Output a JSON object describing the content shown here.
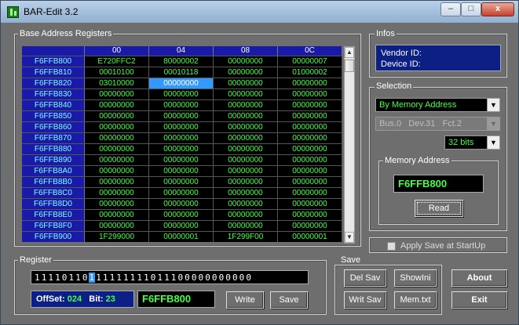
{
  "window": {
    "title": "BAR-Edit 3.2",
    "minimize": "–",
    "maximize": "□",
    "close": "x"
  },
  "bar": {
    "legend": "Base Address Registers",
    "headers": [
      "00",
      "04",
      "08",
      "0C"
    ],
    "rows": [
      {
        "addr": "F6FFB800",
        "v": [
          "E720FFC2",
          "80000002",
          "00000000",
          "00000007"
        ]
      },
      {
        "addr": "F6FFB810",
        "v": [
          "00010100",
          "00010118",
          "00000000",
          "01000002"
        ]
      },
      {
        "addr": "F6FFB820",
        "v": [
          "03010000",
          "00000000",
          "00000000",
          "00000000"
        ]
      },
      {
        "addr": "F6FFB830",
        "v": [
          "00000000",
          "00000000",
          "00000000",
          "00000000"
        ]
      },
      {
        "addr": "F6FFB840",
        "v": [
          "00000000",
          "00000000",
          "00000000",
          "00000000"
        ]
      },
      {
        "addr": "F6FFB850",
        "v": [
          "00000000",
          "00000000",
          "00000000",
          "00000000"
        ]
      },
      {
        "addr": "F6FFB860",
        "v": [
          "00000000",
          "00000000",
          "00000000",
          "00000000"
        ]
      },
      {
        "addr": "F6FFB870",
        "v": [
          "00000000",
          "00000000",
          "00000000",
          "00000000"
        ]
      },
      {
        "addr": "F6FFB880",
        "v": [
          "00000000",
          "00000000",
          "00000000",
          "00000000"
        ]
      },
      {
        "addr": "F6FFB890",
        "v": [
          "00000000",
          "00000000",
          "00000000",
          "00000000"
        ]
      },
      {
        "addr": "F6FFB8A0",
        "v": [
          "00000000",
          "00000000",
          "00000000",
          "00000000"
        ]
      },
      {
        "addr": "F6FFB8B0",
        "v": [
          "00000000",
          "00000000",
          "00000000",
          "00000000"
        ]
      },
      {
        "addr": "F6FFB8C0",
        "v": [
          "00000000",
          "00000000",
          "00000000",
          "00000000"
        ]
      },
      {
        "addr": "F6FFB8D0",
        "v": [
          "00000000",
          "00000000",
          "00000000",
          "00000000"
        ]
      },
      {
        "addr": "F6FFB8E0",
        "v": [
          "00000000",
          "00000000",
          "00000000",
          "00000000"
        ]
      },
      {
        "addr": "F6FFB8F0",
        "v": [
          "00000000",
          "00000000",
          "00000000",
          "00000000"
        ]
      },
      {
        "addr": "F6FFB900",
        "v": [
          "1F299000",
          "00000001",
          "1F299F00",
          "00000001"
        ]
      }
    ],
    "selected": {
      "row": 2,
      "col": 1
    }
  },
  "infos": {
    "legend": "Infos",
    "vendor": "Vendor ID:",
    "device": "Device ID:"
  },
  "selection": {
    "legend": "Selection",
    "mode": "By Memory Address",
    "pci": "Bus.0   Dev.31   Fct.2",
    "width": "32 bits",
    "memory_legend": "Memory Address",
    "memory_address": "F6FFB800",
    "read": "Read"
  },
  "apply_save": "Apply Save at StartUp",
  "register": {
    "legend": "Register",
    "bits": "11110110111111111011100000000000",
    "cursor": 8,
    "offset_label": "OffSet:",
    "offset": "024",
    "bit_label": "Bit:",
    "bit": "23",
    "value": "F6FFB800",
    "write": "Write",
    "save": "Save"
  },
  "save": {
    "legend": "Save",
    "del": "Del Sav",
    "showini": "ShowIni",
    "writ": "Writ Sav",
    "memtxt": "Mem.txt"
  },
  "about": "About",
  "exit": "Exit"
}
